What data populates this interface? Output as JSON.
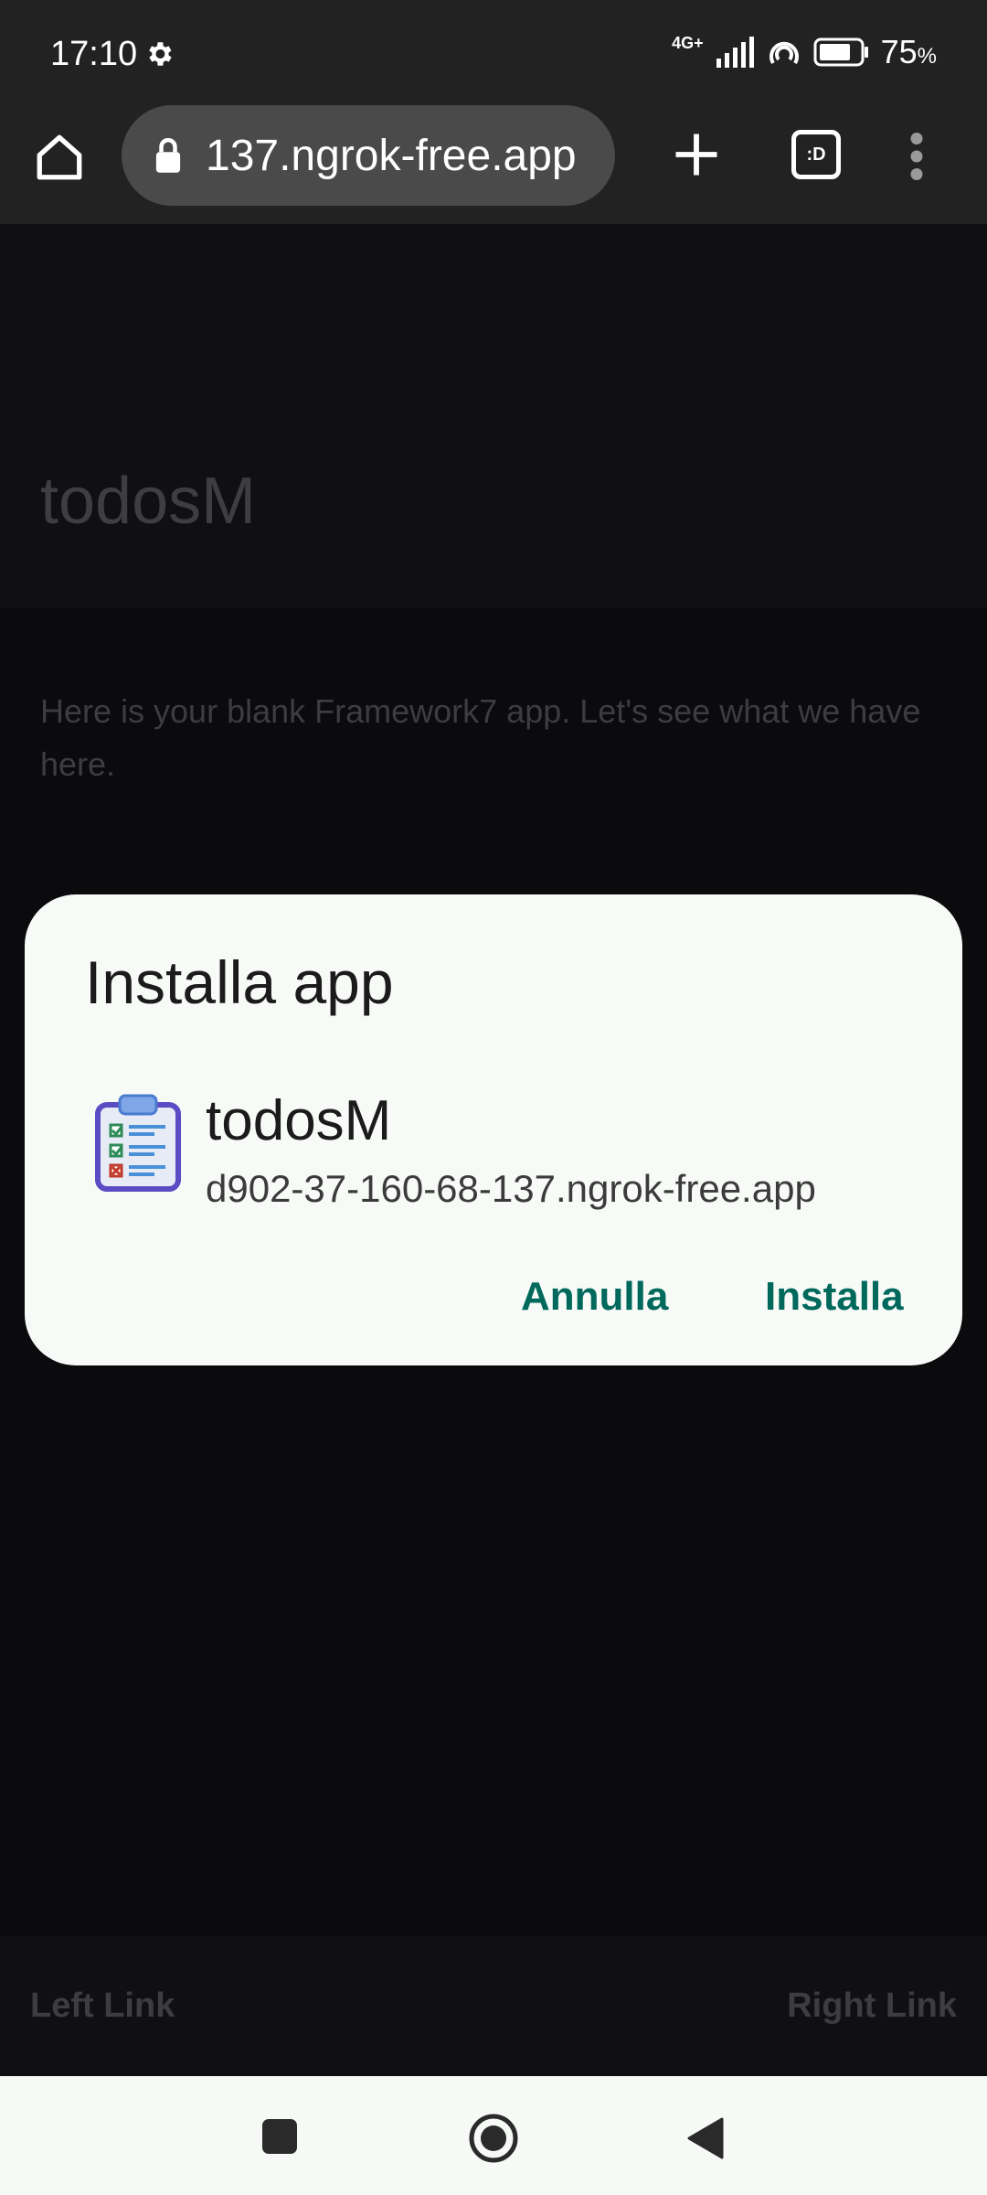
{
  "status_bar": {
    "time": "17:10",
    "network": "4G+",
    "battery_percent": "75",
    "battery_suffix": "%",
    "icons": [
      "settings-icon",
      "signal-icon",
      "hotspot-icon",
      "battery-icon"
    ]
  },
  "browser": {
    "url": "137.ngrok-free.app",
    "tabs_badge": ":D",
    "icons": [
      "home-icon",
      "lock-icon",
      "new-tab-icon",
      "tab-switcher-icon",
      "more-menu-icon"
    ]
  },
  "page": {
    "nav_title": "todosM",
    "block_text": "Here is your blank Framework7 app. Let's see what we have here.",
    "toolbar_left_link": "Left Link",
    "toolbar_right_link": "Right Link"
  },
  "dialog": {
    "title": "Installa app",
    "app_name": "todosM",
    "app_url": "d902-37-160-68-137.ngrok-free.app",
    "cancel_label": "Annulla",
    "install_label": "Installa",
    "accent_color": "#00695c",
    "app_icon": "clipboard-checklist-icon"
  },
  "system_nav": {
    "icons": [
      "recents-icon",
      "home-button-icon",
      "back-icon"
    ]
  }
}
